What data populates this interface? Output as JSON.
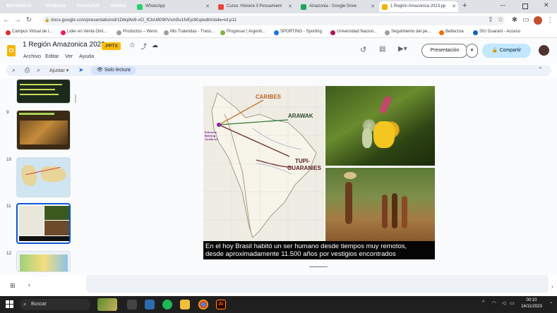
{
  "browser": {
    "tab_groups": [
      {
        "label": "MAYORISTA",
        "color": "#d93025"
      },
      {
        "label": "TRABAJO",
        "color": "#5f6368"
      },
      {
        "label": "FACULTAD",
        "color": "#f29900"
      },
      {
        "label": "VARIOS",
        "color": "#5f6368"
      }
    ],
    "tabs": [
      {
        "title": "WhatsApp",
        "color": "#25d366"
      },
      {
        "title": "Curso: Historia 3 Pensamient",
        "color": "#e8453c"
      },
      {
        "title": "Amazonia - Google Drive",
        "color": "#1fa463"
      },
      {
        "title": "1 Región Amazonica 2023.pp",
        "color": "#f4b400"
      }
    ],
    "url": "docs.google.com/presentation/d/1D6q9w9-xO_fCbU8090Vxm5v1fvEp3Kq/edit#slide=id.p11",
    "bookmarks": [
      {
        "label": "Campus Virtual de l...",
        "color": "#d93025"
      },
      {
        "label": "Lider en Venta Onli...",
        "color": "#e91e63"
      },
      {
        "label": "Productos – Wens",
        "color": "#9e9e9e"
      },
      {
        "label": "Mis Tratendas - Trans...",
        "color": "#9e9e9e"
      },
      {
        "label": "Progresar | Argenti...",
        "color": "#7cb342"
      },
      {
        "label": "SPORTING - Sporting",
        "color": "#1a73e8"
      },
      {
        "label": "Universidad Nacion...",
        "color": "#ad1457"
      },
      {
        "label": "Seguimiento del pe...",
        "color": "#9e9e9e"
      },
      {
        "label": "Betterzoa",
        "color": "#ef6c00"
      },
      {
        "label": "SIU Guaraní - Acceso",
        "color": "#1565c0"
      }
    ]
  },
  "doc": {
    "title": "1 Región Amazonica 2023",
    "badge": ".PPTX",
    "menu": [
      "Archivo",
      "Editar",
      "Ver",
      "Ayuda"
    ],
    "present_label": "Presentación",
    "share_label": "Compartir",
    "toolbar_zoom": "Ajustar",
    "read_only": "Solo lectura"
  },
  "thumbnails": [
    {
      "num": "9"
    },
    {
      "num": "10"
    },
    {
      "num": "11"
    },
    {
      "num": "12"
    }
  ],
  "slide": {
    "map_labels": {
      "caribes": "CARIBES",
      "arawak": "ARAWAK",
      "tupi": "TUPI-",
      "guaranies": "GUARANIES",
      "origin": "Estrecho Behring 13.000 aC"
    },
    "caption_line1": "En el hoy Brasil habitó un ser humano desde tiempos muy remotos,",
    "caption_line2": "desde aproximadamente 11.500 años por vestigios encontrados"
  },
  "taskbar": {
    "search": "Buscar",
    "time": "00:10",
    "date": "14/11/2023"
  }
}
